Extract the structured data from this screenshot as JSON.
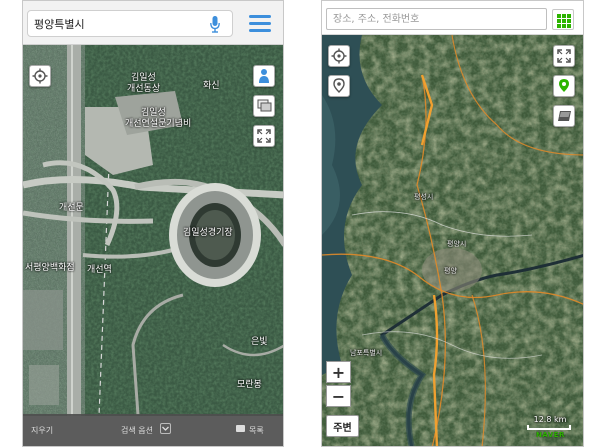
{
  "left": {
    "search": {
      "value": "평양특별시"
    },
    "map_labels": {
      "hwasin": "화신",
      "kim_il_sung_1": "김일성",
      "arch_1": "개선동상",
      "kim_il_sung_2": "김일성",
      "arch_2": "개선연설문기념비",
      "gaeseonmun": "개선문",
      "stadium": "김일성경기장",
      "department_store": "서평양백화점",
      "gaeseon_station": "개선역",
      "eunbit": "은빛",
      "morangbong": "모란봉"
    },
    "bottom": {
      "clear": "지우기",
      "search_options": "검색 옵션",
      "list": "목록"
    }
  },
  "right": {
    "search": {
      "placeholder": "장소, 주소, 전화번호"
    },
    "map_labels": {
      "upper_label": "평성시",
      "city_1": "평양시",
      "city_2": "평양",
      "lower_label": "남포특별시"
    },
    "controls": {
      "zoom_in": "+",
      "zoom_out": "−",
      "nearby": "주변"
    },
    "scale": "12.8 km",
    "brand": "NAVER"
  },
  "colors": {
    "accent_blue": "#3d8fdc",
    "naver_green": "#2db400",
    "bar_gray": "#4e4e4e"
  },
  "icons": [
    "microphone-icon",
    "hamburger-menu-icon",
    "locate-crosshair-icon",
    "street-view-person-icon",
    "layers-icon",
    "fullscreen-expand-icon",
    "location-pin-icon",
    "app-grid-icon",
    "chevron-down-icon",
    "list-icon"
  ]
}
